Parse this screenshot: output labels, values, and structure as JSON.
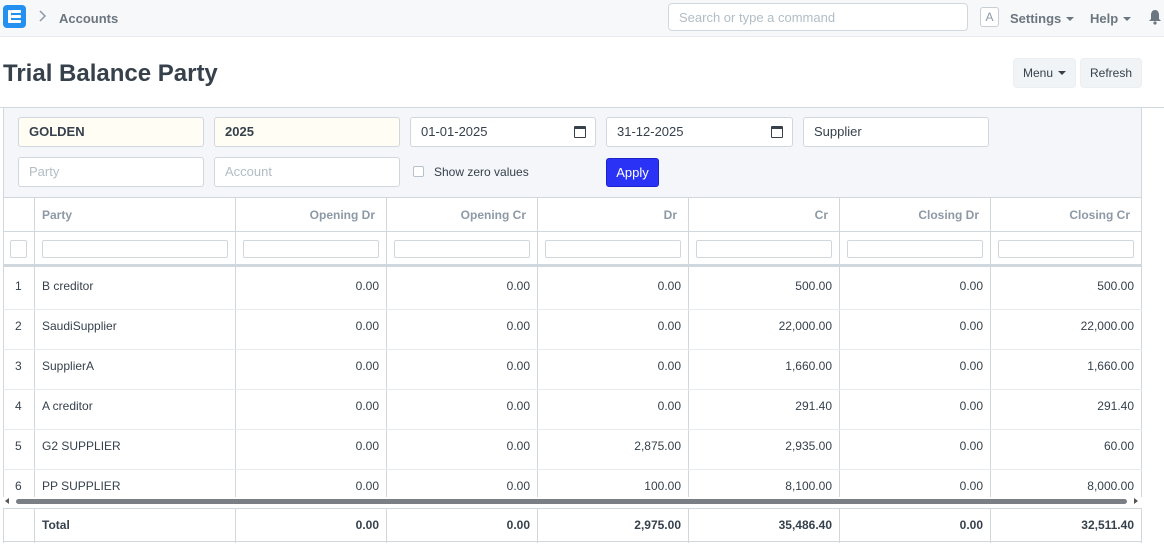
{
  "navbar": {
    "breadcrumb": "Accounts",
    "search_placeholder": "Search or type a command",
    "avatar_letter": "A",
    "settings_label": "Settings",
    "help_label": "Help"
  },
  "page": {
    "title": "Trial Balance Party",
    "menu_label": "Menu",
    "refresh_label": "Refresh"
  },
  "filters": {
    "company": "GOLDEN",
    "fiscal_year": "2025",
    "from_date": "01-01-2025",
    "to_date": "31-12-2025",
    "party_type": "Supplier",
    "party_placeholder": "Party",
    "account_placeholder": "Account",
    "show_zero_label": "Show zero values",
    "apply_label": "Apply"
  },
  "table": {
    "columns": [
      "Party",
      "Opening Dr",
      "Opening Cr",
      "Dr",
      "Cr",
      "Closing Dr",
      "Closing Cr"
    ],
    "rows": [
      {
        "idx": "1",
        "party": "B creditor",
        "opening_dr": "0.00",
        "opening_cr": "0.00",
        "dr": "0.00",
        "cr": "500.00",
        "closing_dr": "0.00",
        "closing_cr": "500.00"
      },
      {
        "idx": "2",
        "party": "SaudiSupplier",
        "opening_dr": "0.00",
        "opening_cr": "0.00",
        "dr": "0.00",
        "cr": "22,000.00",
        "closing_dr": "0.00",
        "closing_cr": "22,000.00"
      },
      {
        "idx": "3",
        "party": "SupplierA",
        "opening_dr": "0.00",
        "opening_cr": "0.00",
        "dr": "0.00",
        "cr": "1,660.00",
        "closing_dr": "0.00",
        "closing_cr": "1,660.00"
      },
      {
        "idx": "4",
        "party": "A creditor",
        "opening_dr": "0.00",
        "opening_cr": "0.00",
        "dr": "0.00",
        "cr": "291.40",
        "closing_dr": "0.00",
        "closing_cr": "291.40"
      },
      {
        "idx": "5",
        "party": "G2 SUPPLIER",
        "opening_dr": "0.00",
        "opening_cr": "0.00",
        "dr": "2,875.00",
        "cr": "2,935.00",
        "closing_dr": "0.00",
        "closing_cr": "60.00"
      },
      {
        "idx": "6",
        "party": "PP SUPPLIER",
        "opening_dr": "0.00",
        "opening_cr": "0.00",
        "dr": "100.00",
        "cr": "8,100.00",
        "closing_dr": "0.00",
        "closing_cr": "8,000.00"
      }
    ],
    "total": {
      "party": "Total",
      "opening_dr": "0.00",
      "opening_cr": "0.00",
      "dr": "2,975.00",
      "cr": "35,486.40",
      "closing_dr": "0.00",
      "closing_cr": "32,511.40"
    }
  },
  "colors": {
    "primary": "#2a33f5",
    "logo": "#2490ef",
    "required_field_bg": "#fffdf4"
  },
  "icons": [
    "app-logo-icon",
    "chevron-right-icon",
    "caret-down-icon",
    "bell-icon",
    "calendar-icon"
  ]
}
